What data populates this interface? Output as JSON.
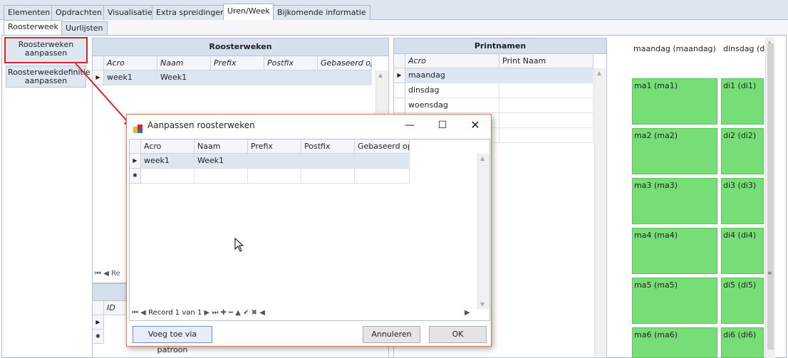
{
  "main_tabs": [
    "Elementen",
    "Opdrachten",
    "Visualisatie",
    "Extra spreidingen",
    "Uren/Week",
    "Bijkomende informatie"
  ],
  "sub_tabs": [
    "Roosterweek",
    "Uurlijsten"
  ],
  "side_buttons": {
    "btn1": "Roosterweken aanpassen",
    "btn2": "Roosterweekdefinitie aanpassen"
  },
  "roosterweken": {
    "title": "Roosterweken",
    "columns": [
      "Acro",
      "Naam",
      "Prefix",
      "Postfix",
      "Gebaseerd op"
    ],
    "rows": [
      {
        "acro": "week1",
        "naam": "Week1",
        "prefix": "",
        "postfix": "",
        "gebaseerd": ""
      }
    ],
    "nav_text": "Re"
  },
  "second_panel": {
    "columns": [
      "ID"
    ]
  },
  "printnamen": {
    "title": "Printnamen",
    "columns": [
      "Acro",
      "Print Naam"
    ],
    "rows": [
      "maandag",
      "dinsdag",
      "woensdag"
    ]
  },
  "schedule": {
    "headers": [
      "maandag (maandag)",
      "dinsdag (din"
    ],
    "col1": [
      "ma1 (ma1)",
      "ma2 (ma2)",
      "ma3 (ma3)",
      "ma4 (ma4)",
      "ma5 (ma5)",
      "ma6 (ma6)"
    ],
    "col2": [
      "di1 (di1)",
      "di2 (di2)",
      "di3 (di3)",
      "di4 (di4)",
      "di5 (di5)",
      "di6 (di6)"
    ],
    "green_color": "#77dd77"
  },
  "dialog": {
    "title": "Aanpassen roosterweken",
    "columns": [
      "Acro",
      "Naam",
      "Prefix",
      "Postfix",
      "Gebaseerd op"
    ],
    "rows": [
      {
        "acro": "week1",
        "naam": "Week1",
        "prefix": "",
        "postfix": "",
        "gebaseerd": ""
      }
    ],
    "record_text": "Record 1 van 1",
    "btn_patroon": "Voeg toe via patroon",
    "btn_annuleren": "Annuleren",
    "btn_ok": "OK"
  },
  "colors": {
    "accent_red": "#d9232e",
    "tab_bg": "#dde5f0",
    "header_bg": "#d6e0ed"
  }
}
